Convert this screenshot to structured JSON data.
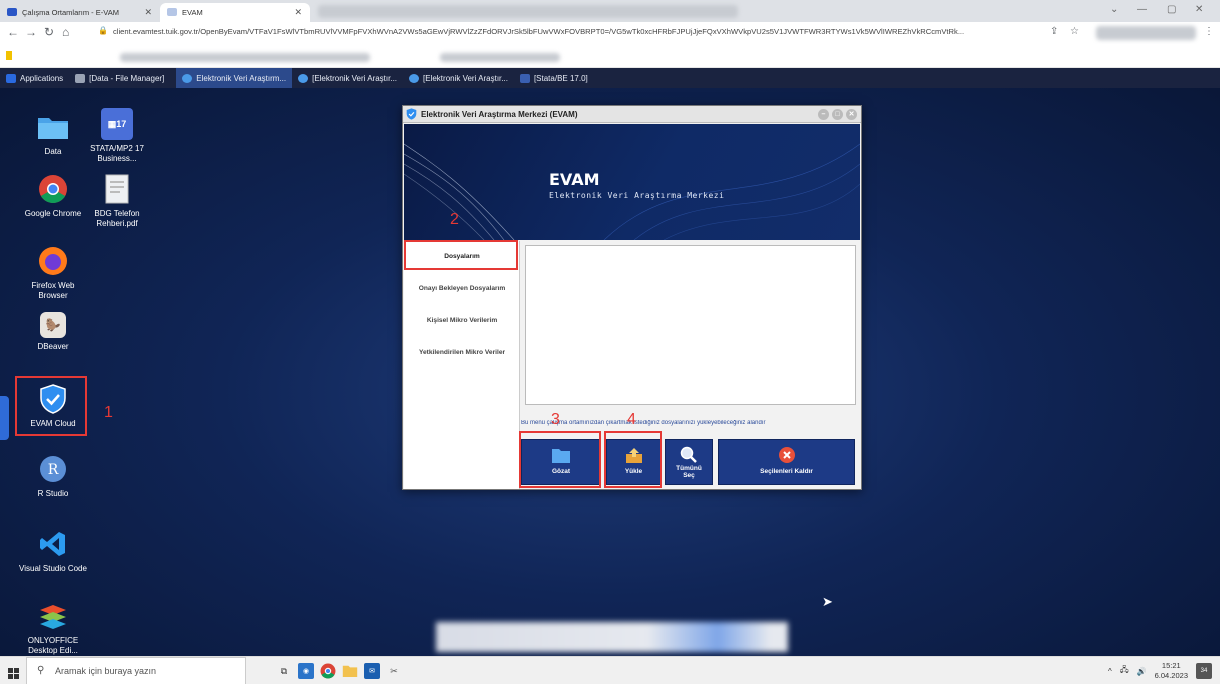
{
  "browser": {
    "tabs": [
      {
        "label": "Çalışma Ortamlarım - E-VAM"
      },
      {
        "label": "EVAM"
      }
    ],
    "url": "client.evamtest.tuik.gov.tr/OpenByEvam/VTFaV1FsWlVTbmRUVlVVMFpFVXhWVnA2VWs5aGEwVjRWVlZzZFdORVJrSk5lbFUwVWxFOVBRPT0=/VG5wTk0xcHFRbFJPUjJjeFQxVXhWVkpVU2s5V1JVWTFWR3RTYWs1Vk5WVlIWREZhVkRCcmVtRk..."
  },
  "panel": {
    "items": [
      {
        "label": "Applications"
      },
      {
        "label": "[Data - File Manager]"
      },
      {
        "label": "Elektronik Veri Araştırm..."
      },
      {
        "label": "[Elektronik Veri Araştır..."
      },
      {
        "label": "[Elektronik Veri Araştır..."
      },
      {
        "label": "[Stata/BE 17.0]"
      }
    ]
  },
  "desktop_icons": [
    {
      "label": "Data"
    },
    {
      "label": "STATA/MP2 17 Business..."
    },
    {
      "label": "Google Chrome"
    },
    {
      "label": "BDG Telefon Rehberi.pdf"
    },
    {
      "label": "Firefox Web Browser"
    },
    {
      "label": "DBeaver"
    },
    {
      "label": "EVAM Cloud"
    },
    {
      "label": "R Studio"
    },
    {
      "label": "Visual Studio Code"
    },
    {
      "label": "ONLYOFFICE Desktop Edi..."
    }
  ],
  "annotations": [
    "1",
    "2",
    "3",
    "4"
  ],
  "evam": {
    "window_title": "Elektronik Veri Araştırma Merkezi (EVAM)",
    "banner_title": "EVAM",
    "banner_subtitle": "Elektronik Veri Araştırma Merkezi",
    "menu": [
      {
        "label": "Dosyalarım"
      },
      {
        "label": "Onayı Bekleyen Dosyalarım"
      },
      {
        "label": "Kişisel Mikro Verilerim"
      },
      {
        "label": "Yetkilendirilen Mikro Veriler"
      }
    ],
    "hint": "Bu menü çalışma ortamınızdan çıkartmak istediğiniz dosyalarınızı yükleyebileceğiniz alandır",
    "buttons": {
      "browse": "Gözat",
      "upload": "Yükle",
      "select_all": "Tümünü Seç",
      "remove_selected": "Seçilenleri Kaldır"
    }
  },
  "taskbar": {
    "search_placeholder": "Aramak için buraya yazın",
    "time": "15:21",
    "date": "6.04.2023",
    "notification_count": "34"
  }
}
